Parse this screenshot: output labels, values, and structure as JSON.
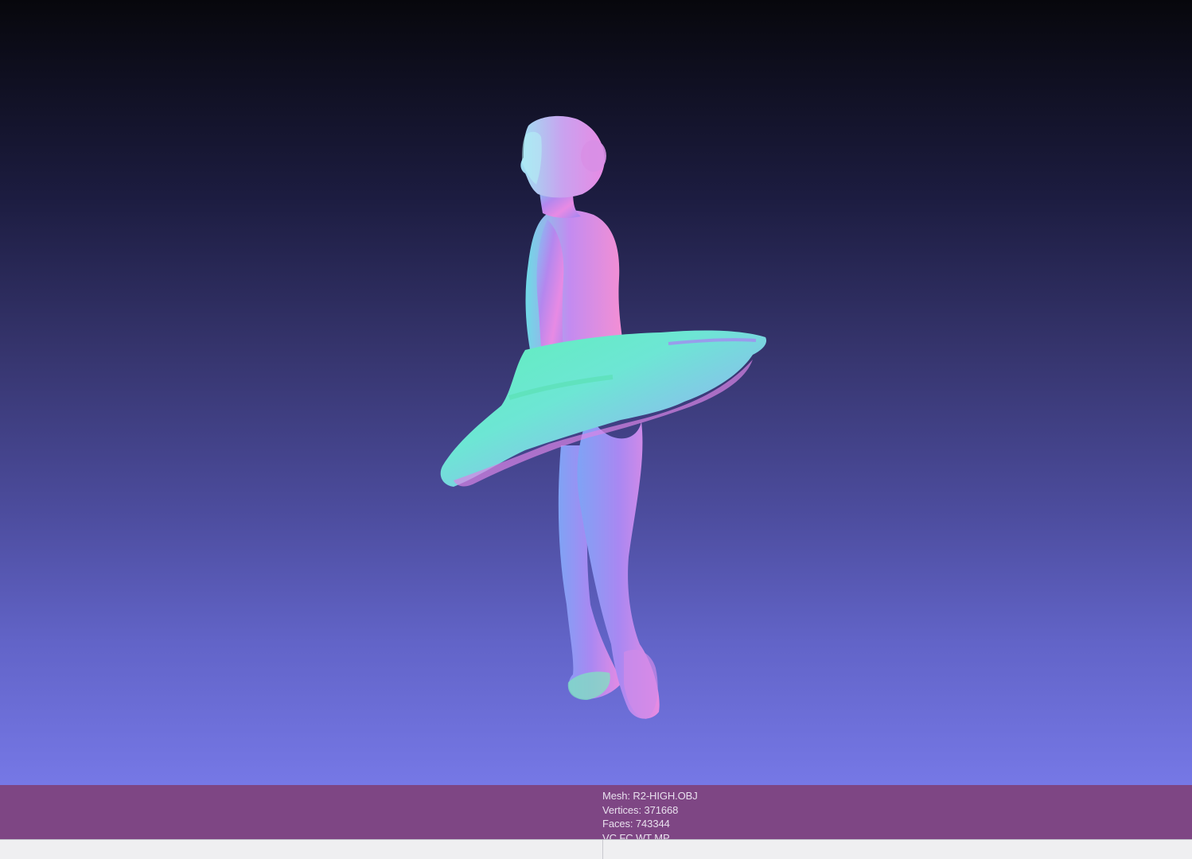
{
  "viewer": {
    "model": "ballerina-normal-map-render",
    "background_top": "#07070c",
    "background_bottom": "#7678e6"
  },
  "info": {
    "mesh": "Mesh: R2-HIGH.OBJ",
    "vertices": "Vertices: 371668",
    "faces": "Faces: 743344",
    "flags": "VC FC WT MP"
  },
  "colors": {
    "info_panel": "#7e4684",
    "info_text": "#e9e0ee",
    "status_bar": "#efeff1"
  }
}
